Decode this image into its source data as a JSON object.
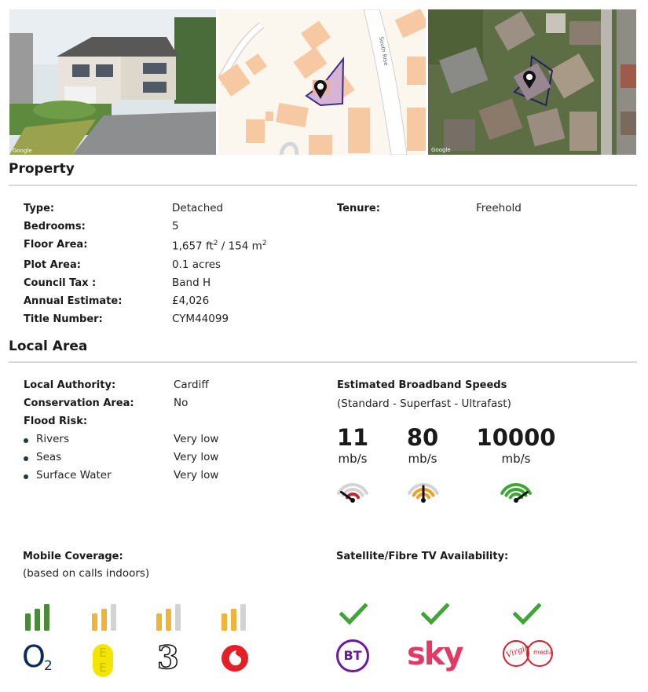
{
  "property": {
    "title": "Property",
    "left": [
      {
        "label": "Type:",
        "value": "Detached"
      },
      {
        "label": "Bedrooms:",
        "value": "5"
      },
      {
        "label": "Floor Area:",
        "value": "1,657 ft² / 154 m²"
      },
      {
        "label": "Plot Area:",
        "value": "0.1 acres"
      },
      {
        "label": "Council Tax :",
        "value": "Band H"
      },
      {
        "label": "Annual Estimate:",
        "value": "£4,026"
      },
      {
        "label": "Title Number:",
        "value": "CYM44099"
      }
    ],
    "tenure": {
      "label": "Tenure:",
      "value": "Freehold"
    }
  },
  "map": {
    "road_label": "South Rise"
  },
  "local_area": {
    "title": "Local Area",
    "authority": {
      "label": "Local Authority:",
      "value": "Cardiff"
    },
    "conservation": {
      "label": "Conservation Area:",
      "value": "No"
    },
    "flood": {
      "label": "Flood Risk:",
      "items": [
        {
          "label": "Rivers",
          "value": "Very low"
        },
        {
          "label": "Seas",
          "value": "Very low"
        },
        {
          "label": "Surface Water",
          "value": "Very low"
        }
      ]
    }
  },
  "broadband": {
    "title": "Estimated Broadband Speeds",
    "subtitle": "(Standard - Superfast - Ultrafast)",
    "speeds": [
      {
        "value": "11",
        "unit": "mb/s",
        "color": "#c0282d",
        "level": 1
      },
      {
        "value": "80",
        "unit": "mb/s",
        "color": "#e9a128",
        "level": 2
      },
      {
        "value": "10000",
        "unit": "mb/s",
        "color": "#3fa535",
        "level": 3
      }
    ]
  },
  "mobile": {
    "title": "Mobile Coverage:",
    "subtitle": "(based on calls indoors)",
    "operators": [
      {
        "name": "O2",
        "logo_text": "O",
        "logo_sub": "2",
        "bars": 3,
        "bar_color": "#4a8a3a",
        "logo_color": "#0b2a5c"
      },
      {
        "name": "EE",
        "logo_text": "E",
        "logo_sub": "E",
        "bars": 2,
        "bar_color": "#f0b33c",
        "logo_color": "#f2e600"
      },
      {
        "name": "Three",
        "logo_text": "3",
        "logo_sub": "",
        "bars": 2,
        "bar_color": "#f0b33c",
        "logo_color": "#111111"
      },
      {
        "name": "Vodafone",
        "logo_text": "",
        "logo_sub": "",
        "bars": 2,
        "bar_color": "#f0b33c",
        "logo_color": "#e41f26"
      }
    ]
  },
  "tv": {
    "title": "Satellite/Fibre TV Availability:",
    "providers": [
      {
        "name": "BT",
        "logo_text": "BT",
        "available": true,
        "color": "#6e1a9e"
      },
      {
        "name": "Sky",
        "logo_text": "sky",
        "available": true,
        "color": "#e23a64"
      },
      {
        "name": "Virgin Media",
        "logo_text": "Virgin",
        "logo_sub": "media",
        "available": true,
        "color": "#d4202c"
      }
    ],
    "check_color": "#3fa535"
  }
}
